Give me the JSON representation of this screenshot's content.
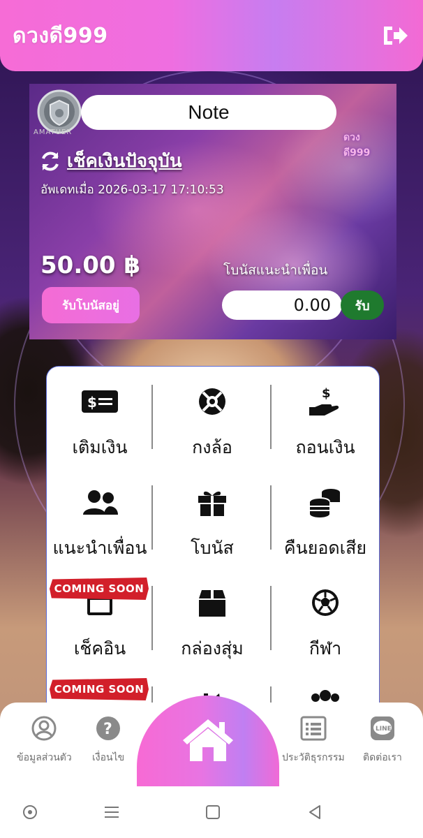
{
  "app": {
    "brand_title": "ดวงดี999",
    "brand_color": "#f46cd4"
  },
  "header": {
    "logout_icon": "logout-icon"
  },
  "card": {
    "rank_label": "AMATUER",
    "note_label": "Note",
    "brand_mark": "ดวงดี999",
    "check_balance_label": "เช็คเงินปัจจุบัน",
    "updated_text": "อัพเดทเมื่อ 2026-03-17 17:10:53",
    "balance": "50.00 ฿",
    "referral_bonus_label": "โบนัสแนะนำเพื่อน",
    "claim_bonus_button": "รับโบนัสอยู่",
    "referral_amount": "0.00",
    "receive_button": "รับ"
  },
  "menu": {
    "items": [
      {
        "label": "เติมเงิน",
        "icon": "money-bill-icon"
      },
      {
        "label": "กงล้อ",
        "icon": "life-ring-icon"
      },
      {
        "label": "ถอนเงิน",
        "icon": "hand-holding-dollar-icon"
      },
      {
        "label": "แนะนำเพื่อน",
        "icon": "users-icon"
      },
      {
        "label": "โบนัส",
        "icon": "gift-icon"
      },
      {
        "label": "คืนยอดเสีย",
        "icon": "coins-icon"
      },
      {
        "label": "เช็คอิน",
        "icon": "calendar-icon",
        "badge": "COMING SOON"
      },
      {
        "label": "กล่องสุ่ม",
        "icon": "box-icon"
      },
      {
        "label": "กีฬา",
        "icon": "soccer-ball-icon"
      }
    ],
    "partial_row_badge": "COMING SOON"
  },
  "bottom_nav": {
    "profile_label": "ข้อมูลส่วนตัว",
    "terms_label": "เงื่อนไข",
    "history_label": "ประวัติธุรกรรม",
    "contact_label": "ติดต่อเรา",
    "line_text": "LINE"
  }
}
